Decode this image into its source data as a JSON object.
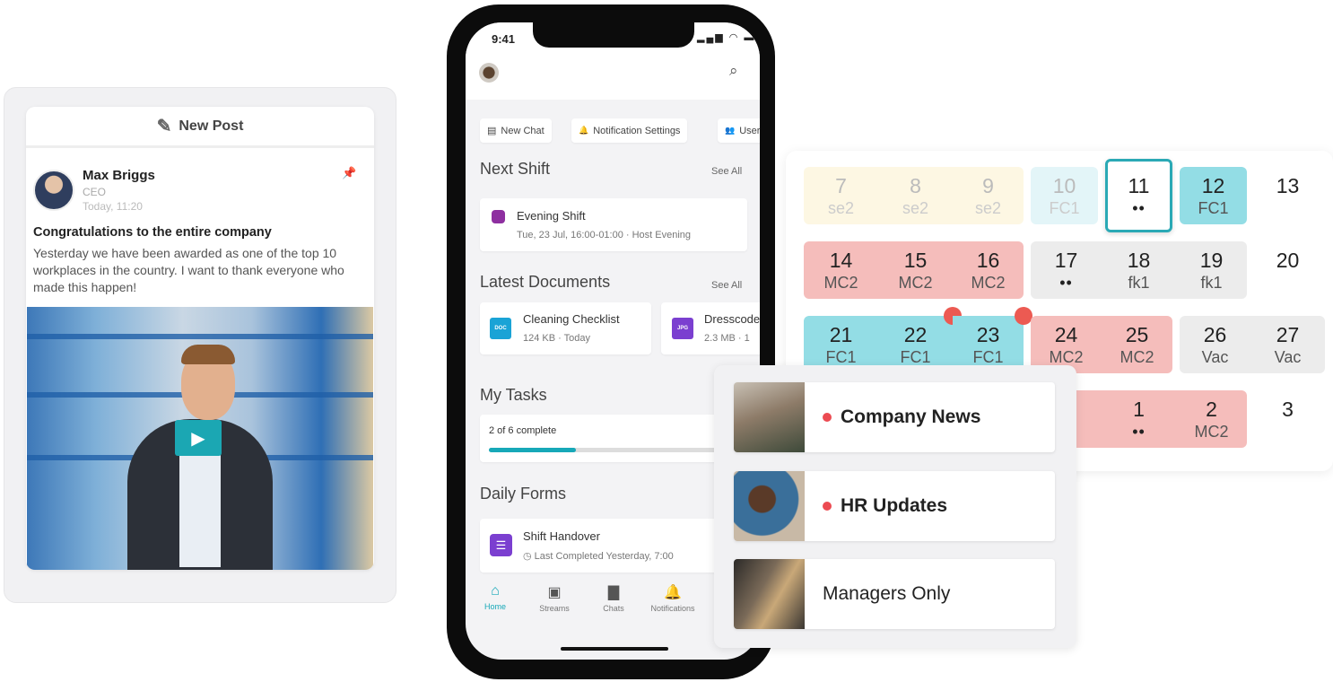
{
  "post_card": {
    "new_post_label": "New Post",
    "author": "Max Briggs",
    "role": "CEO",
    "time": "Today, 11:20",
    "title": "Congratulations to the entire company",
    "body": "Yesterday we have been awarded as one of the top 10 workplaces in the country. I want to thank everyone who made this happen!",
    "play_icon": "play-icon"
  },
  "phone": {
    "status_time": "9:41",
    "status_icons": "▂▄▆ ◠ ▬",
    "chips": [
      {
        "icon": "chat-icon",
        "glyph": "▤",
        "label": "New Chat"
      },
      {
        "icon": "bell-icon",
        "glyph": "🔔",
        "label": "Notification Settings"
      },
      {
        "icon": "users-icon",
        "glyph": "👥",
        "label": "Users"
      }
    ],
    "next_shift": {
      "title": "Next Shift",
      "see_all": "See All",
      "shift_name": "Evening Shift",
      "shift_detail": "Tue, 23 Jul, 16:00-01:00 · Host Evening",
      "color": "#8e2fa0"
    },
    "documents": {
      "title": "Latest Documents",
      "see_all": "See All",
      "items": [
        {
          "badge": "DOC",
          "color": "#1aa3d6",
          "name": "Cleaning Checklist",
          "meta": "124 KB · Today"
        },
        {
          "badge": "JPG",
          "color": "#7b3fd0",
          "name": "Dresscode",
          "meta": "2.3 MB · 1"
        }
      ]
    },
    "tasks": {
      "title": "My Tasks",
      "progress_text": "2 of 6 complete",
      "progress": 0.3333,
      "accent": "#17a8b8"
    },
    "forms": {
      "title": "Daily Forms",
      "name": "Shift Handover",
      "meta": "Last Completed Yesterday, 7:00",
      "color": "#7b3fd0"
    },
    "tabs": [
      {
        "icon": "home-icon",
        "glyph": "⌂",
        "label": "Home",
        "active": true
      },
      {
        "icon": "streams-icon",
        "glyph": "▣",
        "label": "Streams"
      },
      {
        "icon": "chats-icon",
        "glyph": "▇",
        "label": "Chats"
      },
      {
        "icon": "notifications-icon",
        "glyph": "🔔",
        "label": "Notifications"
      }
    ]
  },
  "calendar": {
    "tone_colors": {
      "yellow": "#fdf7e3",
      "cyanFaded": "#e3f5f8",
      "selected": "#ffffff",
      "cyan": "#93dde5",
      "pink": "#f5bdbb",
      "gray": "#ececec",
      "none": "transparent"
    },
    "rows": [
      [
        {
          "day": "7",
          "label": "se2",
          "tone": "yellow",
          "faded": true
        },
        {
          "day": "8",
          "label": "se2",
          "tone": "yellow",
          "faded": true
        },
        {
          "day": "9",
          "label": "se2",
          "tone": "yellow",
          "faded": true
        },
        {
          "day": "10",
          "label": "FC1",
          "tone": "cyanFaded",
          "faded": true
        },
        {
          "day": "11",
          "label": "••",
          "tone": "selected"
        },
        {
          "day": "12",
          "label": "FC1",
          "tone": "cyan"
        },
        {
          "day": "13",
          "label": "",
          "tone": "none"
        }
      ],
      [
        {
          "day": "14",
          "label": "MC2",
          "tone": "pink"
        },
        {
          "day": "15",
          "label": "MC2",
          "tone": "pink"
        },
        {
          "day": "16",
          "label": "MC2",
          "tone": "pink"
        },
        {
          "day": "17",
          "label": "••",
          "tone": "gray"
        },
        {
          "day": "18",
          "label": "fk1",
          "tone": "gray"
        },
        {
          "day": "19",
          "label": "fk1",
          "tone": "gray"
        },
        {
          "day": "20",
          "label": "",
          "tone": "none"
        }
      ],
      [
        {
          "day": "21",
          "label": "FC1",
          "tone": "cyan"
        },
        {
          "day": "22",
          "label": "FC1",
          "tone": "cyan",
          "alert": true
        },
        {
          "day": "23",
          "label": "FC1",
          "tone": "cyan",
          "alert": true
        },
        {
          "day": "24",
          "label": "MC2",
          "tone": "pink2"
        },
        {
          "day": "25",
          "label": "MC2",
          "tone": "pink2"
        },
        {
          "day": "26",
          "label": "Vac",
          "tone": "gray"
        },
        {
          "day": "27",
          "label": "Vac",
          "tone": "gray"
        }
      ],
      [
        {
          "day": "",
          "label": "",
          "tone": "none"
        },
        {
          "day": "",
          "label": "",
          "tone": "none"
        },
        {
          "day": "",
          "label": "",
          "tone": "none"
        },
        {
          "day": "",
          "label": "",
          "tone": "pink"
        },
        {
          "day": "1",
          "label": "••",
          "tone": "pink"
        },
        {
          "day": "2",
          "label": "MC2",
          "tone": "pink"
        },
        {
          "day": "3",
          "label": "",
          "tone": "none"
        }
      ]
    ]
  },
  "channels": [
    {
      "label": "Company News",
      "unread": true,
      "thumb": "mountain"
    },
    {
      "label": "HR Updates",
      "unread": true,
      "thumb": "person"
    },
    {
      "label": "Managers Only",
      "unread": false,
      "thumb": "cafe"
    }
  ]
}
